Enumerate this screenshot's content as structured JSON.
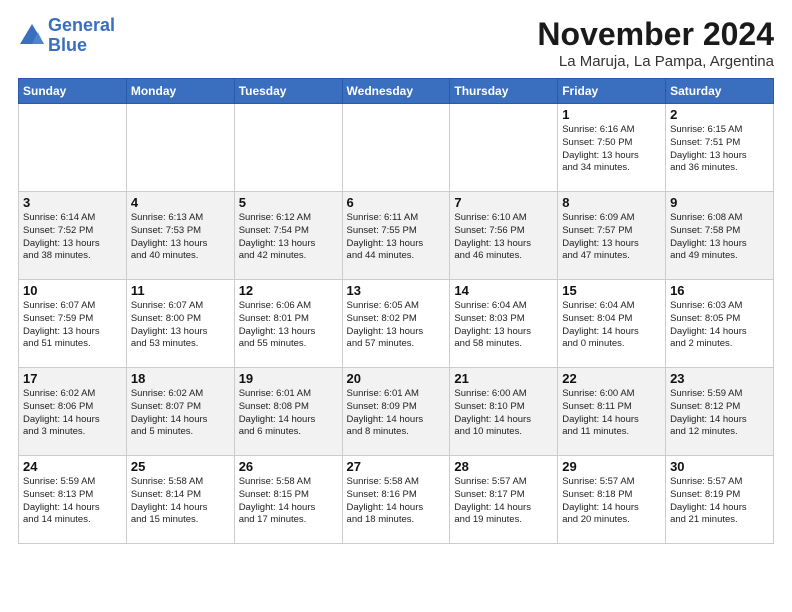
{
  "logo": {
    "text_general": "General",
    "text_blue": "Blue"
  },
  "header": {
    "month": "November 2024",
    "location": "La Maruja, La Pampa, Argentina"
  },
  "weekdays": [
    "Sunday",
    "Monday",
    "Tuesday",
    "Wednesday",
    "Thursday",
    "Friday",
    "Saturday"
  ],
  "weeks": [
    [
      {
        "day": "",
        "info": ""
      },
      {
        "day": "",
        "info": ""
      },
      {
        "day": "",
        "info": ""
      },
      {
        "day": "",
        "info": ""
      },
      {
        "day": "",
        "info": ""
      },
      {
        "day": "1",
        "info": "Sunrise: 6:16 AM\nSunset: 7:50 PM\nDaylight: 13 hours\nand 34 minutes."
      },
      {
        "day": "2",
        "info": "Sunrise: 6:15 AM\nSunset: 7:51 PM\nDaylight: 13 hours\nand 36 minutes."
      }
    ],
    [
      {
        "day": "3",
        "info": "Sunrise: 6:14 AM\nSunset: 7:52 PM\nDaylight: 13 hours\nand 38 minutes."
      },
      {
        "day": "4",
        "info": "Sunrise: 6:13 AM\nSunset: 7:53 PM\nDaylight: 13 hours\nand 40 minutes."
      },
      {
        "day": "5",
        "info": "Sunrise: 6:12 AM\nSunset: 7:54 PM\nDaylight: 13 hours\nand 42 minutes."
      },
      {
        "day": "6",
        "info": "Sunrise: 6:11 AM\nSunset: 7:55 PM\nDaylight: 13 hours\nand 44 minutes."
      },
      {
        "day": "7",
        "info": "Sunrise: 6:10 AM\nSunset: 7:56 PM\nDaylight: 13 hours\nand 46 minutes."
      },
      {
        "day": "8",
        "info": "Sunrise: 6:09 AM\nSunset: 7:57 PM\nDaylight: 13 hours\nand 47 minutes."
      },
      {
        "day": "9",
        "info": "Sunrise: 6:08 AM\nSunset: 7:58 PM\nDaylight: 13 hours\nand 49 minutes."
      }
    ],
    [
      {
        "day": "10",
        "info": "Sunrise: 6:07 AM\nSunset: 7:59 PM\nDaylight: 13 hours\nand 51 minutes."
      },
      {
        "day": "11",
        "info": "Sunrise: 6:07 AM\nSunset: 8:00 PM\nDaylight: 13 hours\nand 53 minutes."
      },
      {
        "day": "12",
        "info": "Sunrise: 6:06 AM\nSunset: 8:01 PM\nDaylight: 13 hours\nand 55 minutes."
      },
      {
        "day": "13",
        "info": "Sunrise: 6:05 AM\nSunset: 8:02 PM\nDaylight: 13 hours\nand 57 minutes."
      },
      {
        "day": "14",
        "info": "Sunrise: 6:04 AM\nSunset: 8:03 PM\nDaylight: 13 hours\nand 58 minutes."
      },
      {
        "day": "15",
        "info": "Sunrise: 6:04 AM\nSunset: 8:04 PM\nDaylight: 14 hours\nand 0 minutes."
      },
      {
        "day": "16",
        "info": "Sunrise: 6:03 AM\nSunset: 8:05 PM\nDaylight: 14 hours\nand 2 minutes."
      }
    ],
    [
      {
        "day": "17",
        "info": "Sunrise: 6:02 AM\nSunset: 8:06 PM\nDaylight: 14 hours\nand 3 minutes."
      },
      {
        "day": "18",
        "info": "Sunrise: 6:02 AM\nSunset: 8:07 PM\nDaylight: 14 hours\nand 5 minutes."
      },
      {
        "day": "19",
        "info": "Sunrise: 6:01 AM\nSunset: 8:08 PM\nDaylight: 14 hours\nand 6 minutes."
      },
      {
        "day": "20",
        "info": "Sunrise: 6:01 AM\nSunset: 8:09 PM\nDaylight: 14 hours\nand 8 minutes."
      },
      {
        "day": "21",
        "info": "Sunrise: 6:00 AM\nSunset: 8:10 PM\nDaylight: 14 hours\nand 10 minutes."
      },
      {
        "day": "22",
        "info": "Sunrise: 6:00 AM\nSunset: 8:11 PM\nDaylight: 14 hours\nand 11 minutes."
      },
      {
        "day": "23",
        "info": "Sunrise: 5:59 AM\nSunset: 8:12 PM\nDaylight: 14 hours\nand 12 minutes."
      }
    ],
    [
      {
        "day": "24",
        "info": "Sunrise: 5:59 AM\nSunset: 8:13 PM\nDaylight: 14 hours\nand 14 minutes."
      },
      {
        "day": "25",
        "info": "Sunrise: 5:58 AM\nSunset: 8:14 PM\nDaylight: 14 hours\nand 15 minutes."
      },
      {
        "day": "26",
        "info": "Sunrise: 5:58 AM\nSunset: 8:15 PM\nDaylight: 14 hours\nand 17 minutes."
      },
      {
        "day": "27",
        "info": "Sunrise: 5:58 AM\nSunset: 8:16 PM\nDaylight: 14 hours\nand 18 minutes."
      },
      {
        "day": "28",
        "info": "Sunrise: 5:57 AM\nSunset: 8:17 PM\nDaylight: 14 hours\nand 19 minutes."
      },
      {
        "day": "29",
        "info": "Sunrise: 5:57 AM\nSunset: 8:18 PM\nDaylight: 14 hours\nand 20 minutes."
      },
      {
        "day": "30",
        "info": "Sunrise: 5:57 AM\nSunset: 8:19 PM\nDaylight: 14 hours\nand 21 minutes."
      }
    ]
  ]
}
